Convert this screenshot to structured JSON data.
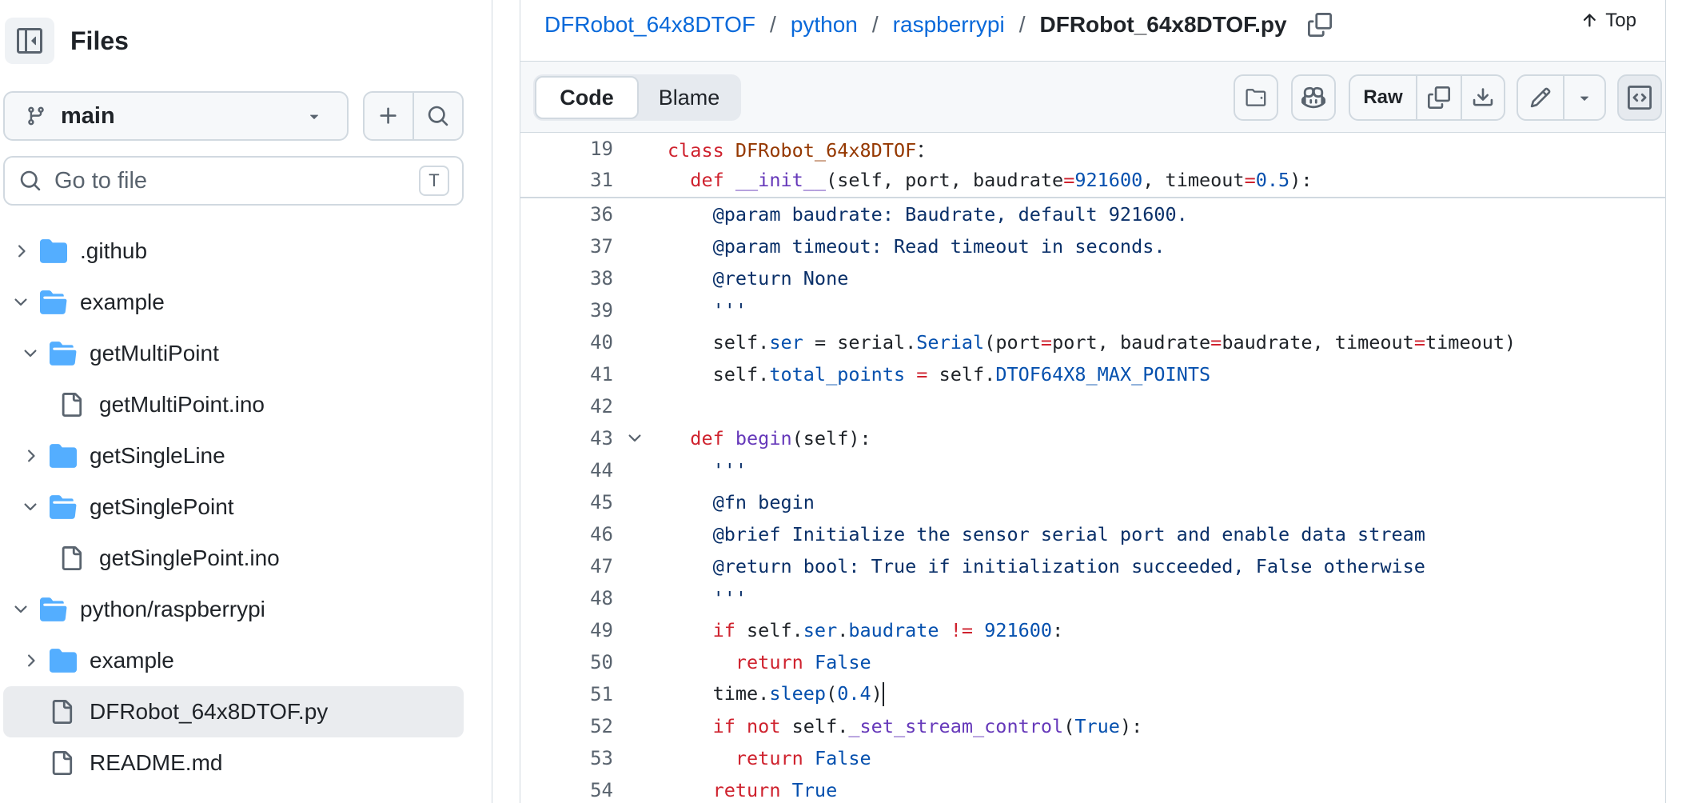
{
  "sidebar": {
    "title": "Files",
    "branch": "main",
    "search_placeholder": "Go to file",
    "search_shortcut": "T",
    "tree": [
      {
        "name": ".github",
        "type": "folder",
        "expanded": false,
        "depth": 0
      },
      {
        "name": "example",
        "type": "folder",
        "expanded": true,
        "depth": 0
      },
      {
        "name": "getMultiPoint",
        "type": "folder",
        "expanded": true,
        "depth": 1
      },
      {
        "name": "getMultiPoint.ino",
        "type": "file",
        "depth": 2
      },
      {
        "name": "getSingleLine",
        "type": "folder",
        "expanded": false,
        "depth": 1
      },
      {
        "name": "getSinglePoint",
        "type": "folder",
        "expanded": true,
        "depth": 1
      },
      {
        "name": "getSinglePoint.ino",
        "type": "file",
        "depth": 2
      },
      {
        "name": "python/raspberrypi",
        "type": "folder",
        "expanded": true,
        "depth": 0
      },
      {
        "name": "example",
        "type": "folder",
        "expanded": false,
        "depth": 1
      },
      {
        "name": "DFRobot_64x8DTOF.py",
        "type": "file",
        "depth": 1,
        "selected": true
      },
      {
        "name": "README.md",
        "type": "file",
        "depth": 1
      }
    ]
  },
  "breadcrumb": {
    "repo": "DFRobot_64x8DTOF",
    "dir1": "python",
    "dir2": "raspberrypi",
    "file": "DFRobot_64x8DTOF.py",
    "separator": "/"
  },
  "top_link": "Top",
  "file_header": {
    "tab_code": "Code",
    "tab_blame": "Blame",
    "raw": "Raw"
  },
  "code": {
    "sticky": [
      {
        "n": "19",
        "tokens": [
          [
            "kw",
            "class "
          ],
          [
            "cls",
            "DFRobot_64x8DTOF"
          ],
          [
            "",
            "："
          ]
        ]
      },
      {
        "n": "31",
        "tokens": [
          [
            "",
            "  "
          ],
          [
            "kw",
            "def "
          ],
          [
            "fn",
            "__init__"
          ],
          [
            "",
            "(self, port, baudrate"
          ],
          [
            "kw",
            "="
          ],
          [
            "num",
            "921600"
          ],
          [
            "",
            ", timeout"
          ],
          [
            "kw",
            "="
          ],
          [
            "num",
            "0.5"
          ],
          [
            "",
            "):"
          ]
        ]
      }
    ],
    "lines": [
      {
        "n": "36",
        "tokens": [
          [
            "str",
            "    @param baudrate: Baudrate, default 921600."
          ]
        ]
      },
      {
        "n": "37",
        "tokens": [
          [
            "str",
            "    @param timeout: Read timeout in seconds."
          ]
        ]
      },
      {
        "n": "38",
        "tokens": [
          [
            "str",
            "    @return None"
          ]
        ]
      },
      {
        "n": "39",
        "tokens": [
          [
            "str",
            "    '''"
          ]
        ]
      },
      {
        "n": "40",
        "tokens": [
          [
            "",
            "    self."
          ],
          [
            "prop",
            "ser"
          ],
          [
            "",
            " = serial."
          ],
          [
            "prop",
            "Serial"
          ],
          [
            "",
            "(port"
          ],
          [
            "kw",
            "="
          ],
          [
            "",
            "port, baudrate"
          ],
          [
            "kw",
            "="
          ],
          [
            "",
            "baudrate, timeout"
          ],
          [
            "kw",
            "="
          ],
          [
            "",
            "timeout)"
          ]
        ]
      },
      {
        "n": "41",
        "tokens": [
          [
            "",
            "    self."
          ],
          [
            "prop",
            "total_points"
          ],
          [
            "",
            " "
          ],
          [
            "kw",
            "="
          ],
          [
            "",
            " self."
          ],
          [
            "prop",
            "DTOF64X8_MAX_POINTS"
          ]
        ]
      },
      {
        "n": "42",
        "tokens": [
          [
            "",
            ""
          ]
        ]
      },
      {
        "n": "43",
        "fold": true,
        "tokens": [
          [
            "",
            "  "
          ],
          [
            "kw",
            "def "
          ],
          [
            "fn",
            "begin"
          ],
          [
            "",
            "(self):"
          ]
        ]
      },
      {
        "n": "44",
        "tokens": [
          [
            "str",
            "    '''"
          ]
        ]
      },
      {
        "n": "45",
        "tokens": [
          [
            "str",
            "    @fn begin"
          ]
        ]
      },
      {
        "n": "46",
        "tokens": [
          [
            "str",
            "    @brief Initialize the sensor serial port and enable data stream"
          ]
        ]
      },
      {
        "n": "47",
        "tokens": [
          [
            "str",
            "    @return bool: True if initialization succeeded, False otherwise"
          ]
        ]
      },
      {
        "n": "48",
        "tokens": [
          [
            "str",
            "    '''"
          ]
        ]
      },
      {
        "n": "49",
        "tokens": [
          [
            "",
            "    "
          ],
          [
            "kw",
            "if"
          ],
          [
            "",
            " self."
          ],
          [
            "prop",
            "ser"
          ],
          [
            "",
            "."
          ],
          [
            "prop",
            "baudrate"
          ],
          [
            "",
            " "
          ],
          [
            "kw",
            "!="
          ],
          [
            "",
            " "
          ],
          [
            "num",
            "921600"
          ],
          [
            "",
            ":"
          ]
        ]
      },
      {
        "n": "50",
        "tokens": [
          [
            "",
            "      "
          ],
          [
            "kw",
            "return "
          ],
          [
            "num",
            "False"
          ]
        ]
      },
      {
        "n": "51",
        "caret": true,
        "tokens": [
          [
            "",
            "    time."
          ],
          [
            "prop",
            "sleep"
          ],
          [
            "",
            "("
          ],
          [
            "num",
            "0.4"
          ],
          [
            "",
            ")"
          ]
        ]
      },
      {
        "n": "52",
        "tokens": [
          [
            "",
            "    "
          ],
          [
            "kw",
            "if not"
          ],
          [
            "",
            " self."
          ],
          [
            "fn",
            "_set_stream_control"
          ],
          [
            "",
            "("
          ],
          [
            "num",
            "True"
          ],
          [
            "",
            "):"
          ]
        ]
      },
      {
        "n": "53",
        "tokens": [
          [
            "",
            "      "
          ],
          [
            "kw",
            "return "
          ],
          [
            "num",
            "False"
          ]
        ]
      },
      {
        "n": "54",
        "tokens": [
          [
            "",
            "    "
          ],
          [
            "kw",
            "return "
          ],
          [
            "num",
            "True"
          ]
        ]
      }
    ]
  }
}
